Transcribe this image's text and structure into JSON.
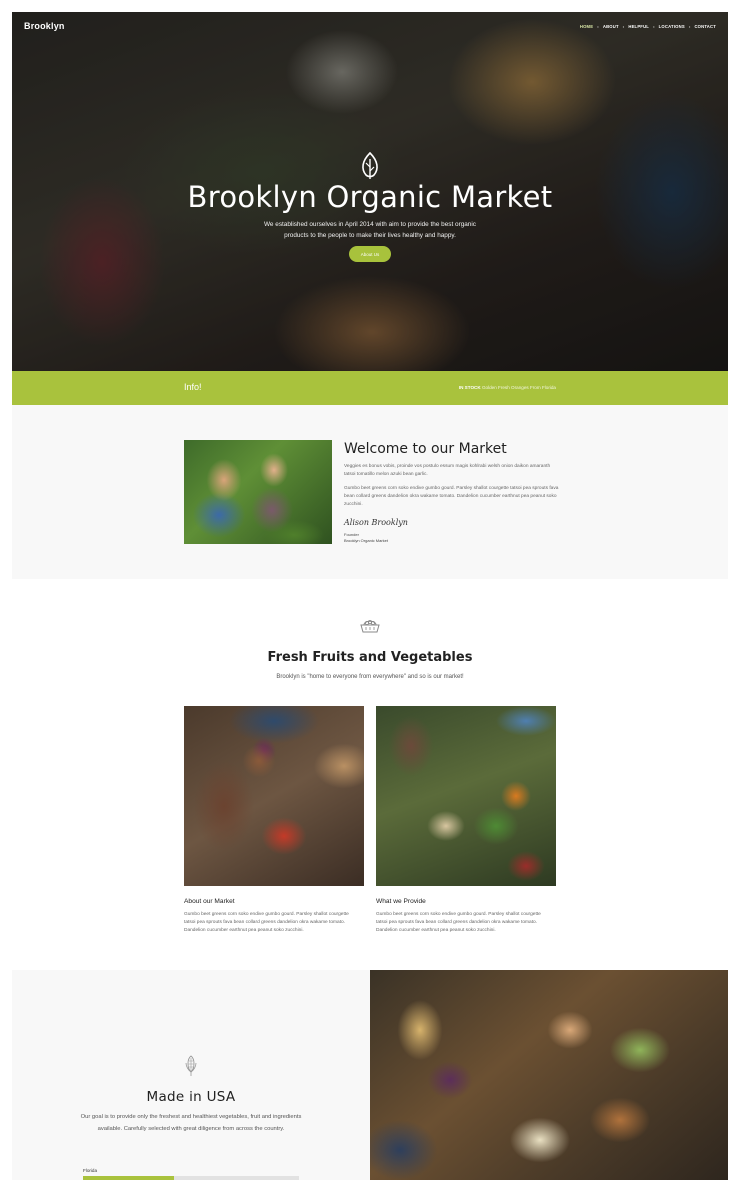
{
  "header": {
    "brand": "Brooklyn",
    "nav": [
      "HOME",
      "ABOUT",
      "HELPFUL",
      "LOCATIONS",
      "CONTACT"
    ]
  },
  "hero": {
    "title": "Brooklyn Organic Market",
    "subtitle": "We established ourselves in April 2014 with aim to provide the best organic products to the people to make their lives healthy and happy.",
    "button": "About Us",
    "icon": "leaf-icon"
  },
  "infobar": {
    "title": "Info!",
    "news_tag": "IN STOCK",
    "news_text": "Golden Fresh Oranges From Florida"
  },
  "welcome": {
    "title": "Welcome to our Market",
    "paragraph1": "Veggies es bonus vobis, proinde vos postulo essum magis kohlrabi welsh onion daikon amaranth tatsoi tomatillo melon azuki bean garlic.",
    "paragraph2": "Gumbo beet greens corn soko endive gumbo gourd. Parsley shallot courgette tatsoi pea sprouts fava bean collard greens dandelion okra wakame tomato. Dandelion cucumber earthnut pea peanut soko zucchini.",
    "signature": "Alison Brooklyn",
    "role": "Founder",
    "org": "Brooklyn Organic Market"
  },
  "fresh": {
    "icon": "basket-icon",
    "title": "Fresh Fruits and Vegetables",
    "subtitle": "Brooklyn is \"home to everyone from everywhere\" and so is our market!",
    "cards": [
      {
        "title": "About our Market",
        "text": "Gumbo beet greens corn soko endive gumbo gourd. Parsley shallot courgette tatsoi pea sprouts fava bean collard greens dandelion okra wakame tomato. Dandelion cucumber earthnut pea peanut soko zucchini."
      },
      {
        "title": "What we Provide",
        "text": "Gumbo beet greens corn soko endive gumbo gourd. Parsley shallot courgette tatsoi pea sprouts fava bean collard greens dandelion okra wakame tomato. Dandelion cucumber earthnut pea peanut soko zucchini."
      }
    ]
  },
  "usa": {
    "icon": "corn-icon",
    "title": "Made in USA",
    "text": "Our goal is to provide only the freshest and healthiest vegetables, fruit and ingredients available. Carefully selected with great diligence from across the country.",
    "bar_label": "Florida",
    "bar_percent": 42
  },
  "colors": {
    "accent": "#a9c23d",
    "light_bg": "#f8f8f8"
  }
}
